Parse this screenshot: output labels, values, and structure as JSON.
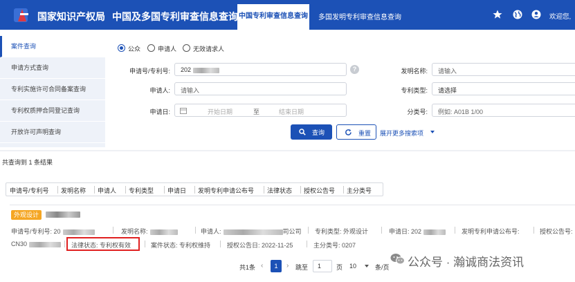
{
  "header": {
    "org_name": "国家知识产权局",
    "system_name": "中国及多国专利审查信息查询",
    "tabs": [
      {
        "label": "中国专利审查信息查询",
        "active": true
      },
      {
        "label": "多国发明专利审查信息查询",
        "active": false
      }
    ],
    "icons": [
      "star-icon",
      "globe-icon",
      "user-icon"
    ],
    "welcome": "欢迎您,",
    "brand_color": "#1c51b6"
  },
  "sidebar": {
    "items": [
      {
        "label": "案件查询",
        "active": true
      },
      {
        "label": "申请方式查询"
      },
      {
        "label": "专利实施许可合同备案查询"
      },
      {
        "label": "专利权质押合同登记查询"
      },
      {
        "label": "开放许可声明查询"
      }
    ]
  },
  "search": {
    "radio_options": [
      "公众",
      "申请人",
      "无效请求人"
    ],
    "radio_selected": "公众",
    "fields": {
      "app_no_label": "申请号/专利号:",
      "app_no_value": "202",
      "applicant_label": "申请人:",
      "applicant_placeholder": "请输入",
      "date_label": "申请日:",
      "date_start_placeholder": "开始日期",
      "date_to": "至",
      "date_end_placeholder": "结束日期",
      "invention_label": "发明名称:",
      "invention_placeholder": "请输入",
      "type_label": "专利类型:",
      "type_placeholder": "请选择",
      "class_label": "分类号:",
      "class_placeholder": "例如: A01B 1/00"
    },
    "search_button": "查询",
    "reset_button": "重置",
    "more_options": "展开更多搜索项"
  },
  "results": {
    "count_text": "共查询到 1 条结果",
    "sort_columns": [
      "申请号/专利号",
      "发明名称",
      "申请人",
      "专利类型",
      "申请日",
      "发明专利申请公布号",
      "法律状态",
      "授权公告号",
      "主分类号"
    ],
    "card": {
      "badge": "外观设计",
      "row1": {
        "app_no": "申请号/专利号: 20",
        "name": "发明名称:",
        "applicant": "申请人:",
        "applicant_suffix": "司公司",
        "type": "专利类型: 外观设计",
        "date": "申请日: 202",
        "pub_no": "发明专利申请公布号:",
        "grant_no": "授权公告号:"
      },
      "row2": {
        "grant_code": "CN30",
        "legal_status": "法律状态: 专利权有效",
        "case_status": "案件状态: 专利权维持",
        "grant_date": "授权公告日: 2022-11-25",
        "main_class": "主分类号: 0207"
      }
    }
  },
  "pagination": {
    "total": "共1条",
    "current_page": "1",
    "goto_label": "跳至",
    "goto_value": "1",
    "page_unit": "页",
    "page_size": "10",
    "page_size_unit": "条/页"
  },
  "watermark": {
    "text": "公众号 · 瀚诚商法资讯"
  }
}
